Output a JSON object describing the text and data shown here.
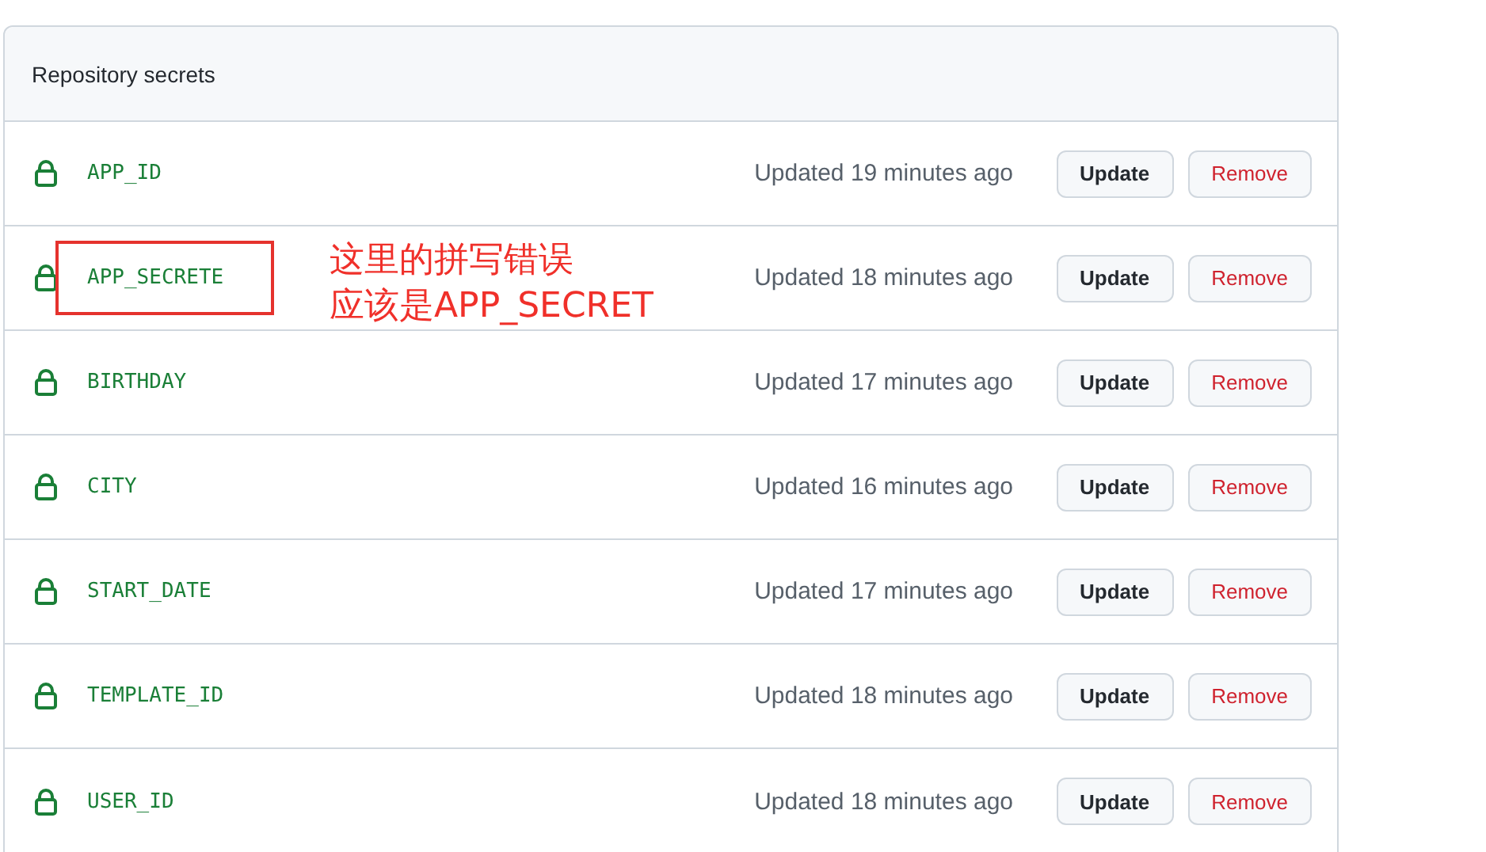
{
  "panel": {
    "title": "Repository secrets"
  },
  "secrets": [
    {
      "name": "APP_ID",
      "updated": "Updated 19 minutes ago",
      "update_label": "Update",
      "remove_label": "Remove",
      "highlighted": false
    },
    {
      "name": "APP_SECRETE",
      "updated": "Updated 18 minutes ago",
      "update_label": "Update",
      "remove_label": "Remove",
      "highlighted": true
    },
    {
      "name": "BIRTHDAY",
      "updated": "Updated 17 minutes ago",
      "update_label": "Update",
      "remove_label": "Remove",
      "highlighted": false
    },
    {
      "name": "CITY",
      "updated": "Updated 16 minutes ago",
      "update_label": "Update",
      "remove_label": "Remove",
      "highlighted": false
    },
    {
      "name": "START_DATE",
      "updated": "Updated 17 minutes ago",
      "update_label": "Update",
      "remove_label": "Remove",
      "highlighted": false
    },
    {
      "name": "TEMPLATE_ID",
      "updated": "Updated 18 minutes ago",
      "update_label": "Update",
      "remove_label": "Remove",
      "highlighted": false
    },
    {
      "name": "USER_ID",
      "updated": "Updated 18 minutes ago",
      "update_label": "Update",
      "remove_label": "Remove",
      "highlighted": false
    }
  ],
  "annotation": {
    "lines": [
      "这里的拼写错误",
      "应该是APP_SECRET"
    ]
  }
}
